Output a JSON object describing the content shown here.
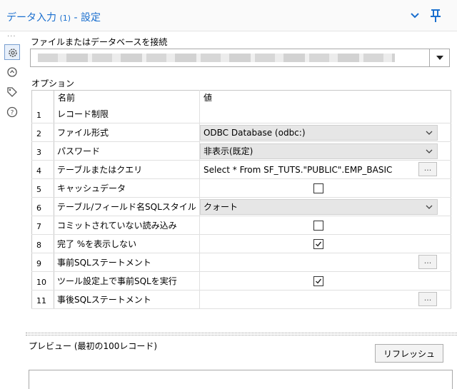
{
  "window": {
    "title_prefix": "データ入力",
    "title_num": "(1)",
    "title_suffix": " - 設定"
  },
  "sidebar": {
    "icons": [
      "gear-icon",
      "target-icon",
      "tag-icon",
      "help-icon"
    ]
  },
  "connection": {
    "label": "ファイルまたはデータベースを接続"
  },
  "options": {
    "label": "オプション",
    "header_name": "名前",
    "header_value": "値",
    "rows": [
      {
        "num": "1",
        "name": "レコード制限"
      },
      {
        "num": "2",
        "name": "ファイル形式",
        "value": "ODBC Database (odbc:)"
      },
      {
        "num": "3",
        "name": "パスワード",
        "value": "非表示(既定)"
      },
      {
        "num": "4",
        "name": "テーブルまたはクエリ",
        "value": "Select * From SF_TUTS.\"PUBLIC\".EMP_BASIC",
        "button": "..."
      },
      {
        "num": "5",
        "name": "キャッシュデータ",
        "checked": false
      },
      {
        "num": "6",
        "name": "テーブル/フィールド名SQLスタイル",
        "value": "クォート"
      },
      {
        "num": "7",
        "name": "コミットされていない読み込み",
        "checked": false
      },
      {
        "num": "8",
        "name": "完了 %を表示しない",
        "checked": true
      },
      {
        "num": "9",
        "name": "事前SQLステートメント",
        "button": "..."
      },
      {
        "num": "10",
        "name": "ツール設定上で事前SQLを実行",
        "checked": true
      },
      {
        "num": "11",
        "name": "事後SQLステートメント",
        "button": "..."
      }
    ]
  },
  "preview": {
    "label": "プレビュー (最初の100レコード)",
    "refresh_label": "リフレッシュ"
  },
  "colors": {
    "title": "#1a6fcf",
    "select_bg": "#e6e6e6"
  }
}
